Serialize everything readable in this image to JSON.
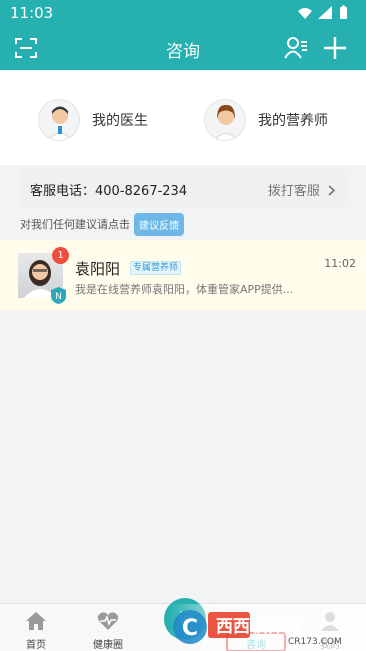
{
  "status_bar": {
    "time": "11:03"
  },
  "header": {
    "title": "咨询"
  },
  "quick_access": [
    {
      "label": "我的医生",
      "icon": "doctor-avatar"
    },
    {
      "label": "我的营养师",
      "icon": "nutritionist-avatar"
    }
  ],
  "service": {
    "phone_label": "客服电话：400-8267-234",
    "call_label": "拨打客服",
    "chevron": "chevron-right-icon"
  },
  "feedback": {
    "prompt": "对我们任何建议请点击",
    "button": "建议反馈"
  },
  "conversations": [
    {
      "name": "袁阳阳",
      "tag": "专属营养师",
      "time": "11:02",
      "unread": "1",
      "badge_letter": "N",
      "preview": "我是在线营养师袁阳阳，体重管家APP提供..."
    }
  ],
  "tabs": [
    {
      "label": "首页",
      "icon": "home-icon"
    },
    {
      "label": "健康圈",
      "icon": "heart-pulse-icon"
    },
    {
      "label": "记",
      "icon": "record-button"
    },
    {
      "label": "咨询",
      "icon": "chat-icon"
    },
    {
      "label": "我的",
      "icon": "person-icon"
    }
  ],
  "watermark": {
    "brand": "西西软件园",
    "domain": "CR173.COM",
    "logo_letter": "C"
  },
  "colors": {
    "accent": "#26b0b0",
    "badge": "#f04c3e",
    "feedback_button": "#6db8e8",
    "highlight_row": "#fffcec",
    "annotation_box": "#e03131"
  }
}
